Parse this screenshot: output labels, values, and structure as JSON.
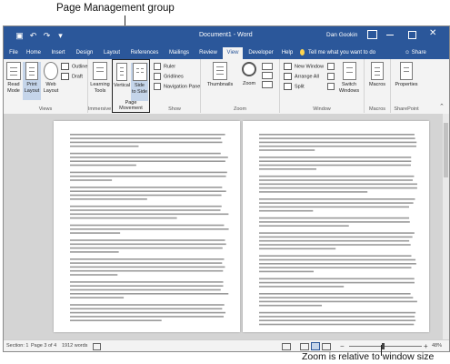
{
  "callouts": {
    "top": "Page Management group",
    "bottom": "Zoom is relative to window size"
  },
  "titlebar": {
    "title": "Document1 - Word",
    "user": "Dan Gookin",
    "qat_icons": [
      "save-icon",
      "undo-icon",
      "redo-icon",
      "customize-icon"
    ]
  },
  "tabs": [
    "File",
    "Home",
    "Insert",
    "Design",
    "Layout",
    "References",
    "Mailings",
    "Review",
    "View",
    "Developer",
    "Help"
  ],
  "active_tab": "View",
  "tell_me": "Tell me what you want to do",
  "share": "Share",
  "ribbon": {
    "views": {
      "label": "Views",
      "read_mode": [
        "Read",
        "Mode"
      ],
      "print_layout": [
        "Print",
        "Layout"
      ],
      "web_layout": [
        "Web",
        "Layout"
      ],
      "outline": "Outline",
      "draft": "Draft"
    },
    "immersive": {
      "label": "Immersive",
      "learning_tools": [
        "Learning",
        "Tools"
      ]
    },
    "page_movement": {
      "label": "Page Movement",
      "vertical": "Vertical",
      "side_to_side": [
        "Side",
        "to Side"
      ]
    },
    "show": {
      "label": "Show",
      "ruler": "Ruler",
      "gridlines": "Gridlines",
      "navigation_pane": "Navigation Pane"
    },
    "zoom": {
      "label": "Zoom",
      "thumbnails": "Thumbnails",
      "zoom": "Zoom"
    },
    "window": {
      "label": "Window",
      "new_window": "New Window",
      "arrange_all": "Arrange All",
      "split": "Split",
      "switch_windows": [
        "Switch",
        "Windows"
      ]
    },
    "macros": {
      "label": "Macros",
      "macros": "Macros"
    },
    "sharepoint": {
      "label": "SharePoint",
      "properties": "Properties"
    }
  },
  "status": {
    "section": "Section: 1",
    "page": "Page 3 of 4",
    "words": "1912 words",
    "zoom": "48%"
  }
}
